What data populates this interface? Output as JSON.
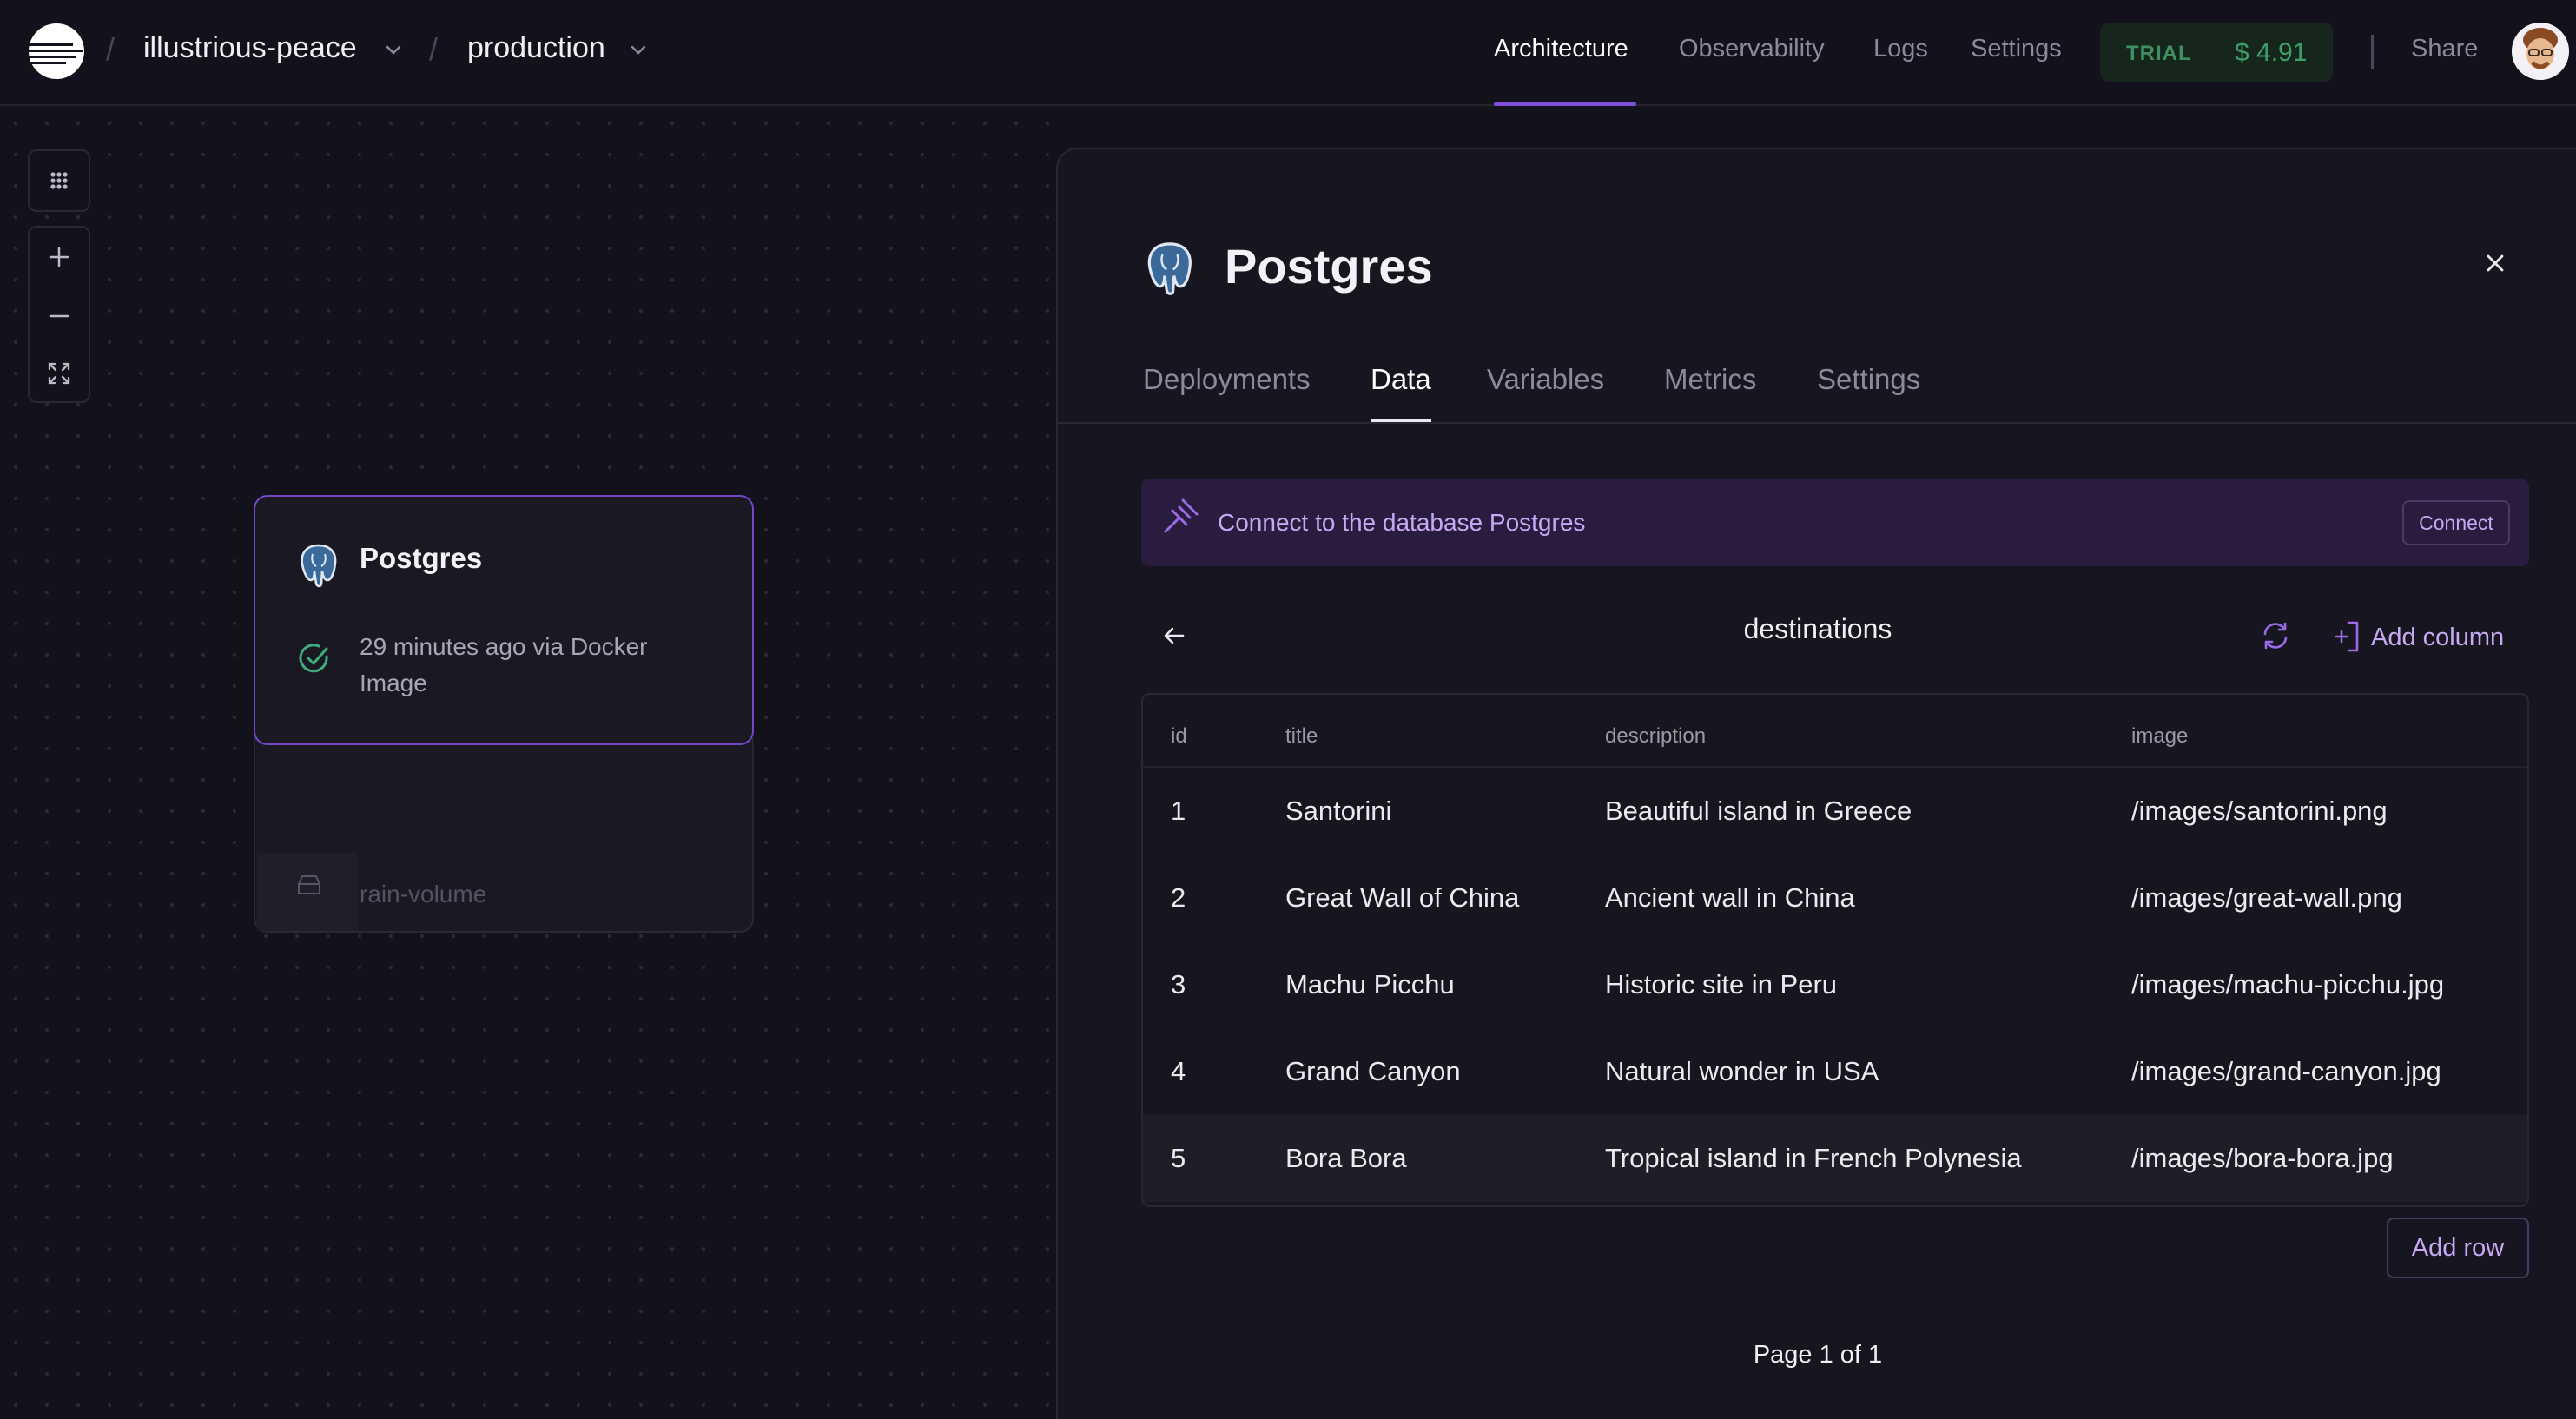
{
  "header": {
    "project": "illustrious-peace",
    "environment": "production",
    "separator": "/",
    "nav": [
      "Architecture",
      "Observability",
      "Logs",
      "Settings"
    ],
    "active_nav": "Architecture",
    "trial_label": "TRIAL",
    "trial_amount": "$ 4.91",
    "share_label": "Share"
  },
  "canvas": {
    "service_card": {
      "name": "Postgres",
      "status": "29 minutes ago via Docker Image",
      "volume": "rain-volume"
    }
  },
  "panel": {
    "title": "Postgres",
    "tabs": [
      "Deployments",
      "Data",
      "Variables",
      "Metrics",
      "Settings"
    ],
    "active_tab": "Data",
    "connect_text": "Connect to the database Postgres",
    "connect_button": "Connect",
    "table_name": "destinations",
    "add_column_label": "Add column",
    "columns": [
      "id",
      "title",
      "description",
      "image"
    ],
    "rows": [
      [
        "1",
        "Santorini",
        "Beautiful island in Greece",
        "/images/santorini.png"
      ],
      [
        "2",
        "Great Wall of China",
        "Ancient wall in China",
        "/images/great-wall.png"
      ],
      [
        "3",
        "Machu Picchu",
        "Historic site in Peru",
        "/images/machu-picchu.jpg"
      ],
      [
        "4",
        "Grand Canyon",
        "Natural wonder in USA",
        "/images/grand-canyon.jpg"
      ],
      [
        "5",
        "Bora Bora",
        "Tropical island in French Polynesia",
        "/images/bora-bora.jpg"
      ]
    ],
    "add_row_label": "Add row",
    "pagination": "Page 1 of 1"
  },
  "colors": {
    "accent": "#7d4fd6",
    "accent_text": "#c6a9f2",
    "trial_green": "#3f9f69",
    "status_green": "#3fae7a"
  }
}
